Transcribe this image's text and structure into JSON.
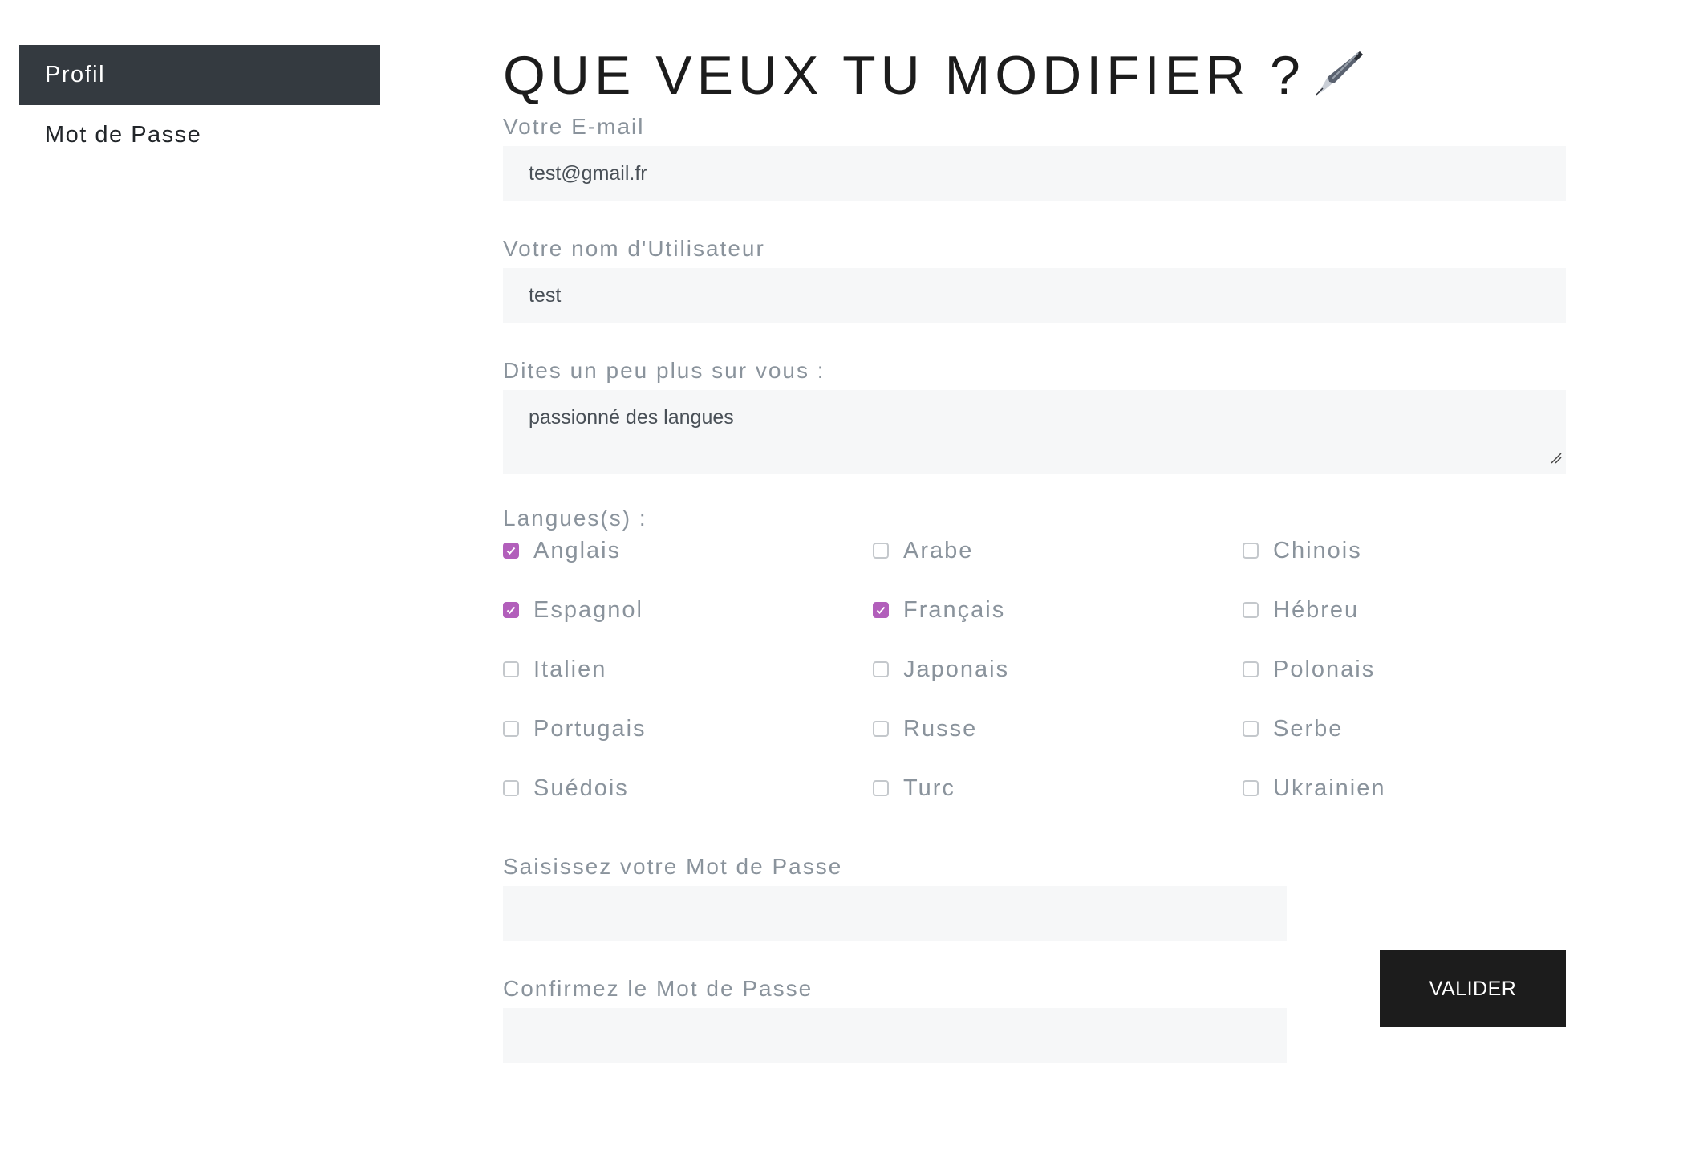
{
  "sidebar": {
    "items": [
      {
        "label": "Profil",
        "active": true
      },
      {
        "label": "Mot de Passe",
        "active": false
      }
    ]
  },
  "page": {
    "title": "QUE VEUX TU MODIFIER ?",
    "title_icon": "fountain-pen-icon"
  },
  "form": {
    "email_label": "Votre E-mail",
    "email_value": "test@gmail.fr",
    "username_label": "Votre nom d'Utilisateur",
    "username_value": "test",
    "bio_label": "Dites un peu plus sur vous :",
    "bio_value": "passionné des langues",
    "languages_label": "Langues(s) :",
    "languages": [
      {
        "label": "Anglais",
        "checked": true
      },
      {
        "label": "Arabe",
        "checked": false
      },
      {
        "label": "Chinois",
        "checked": false
      },
      {
        "label": "Espagnol",
        "checked": true
      },
      {
        "label": "Français",
        "checked": true
      },
      {
        "label": "Hébreu",
        "checked": false
      },
      {
        "label": "Italien",
        "checked": false
      },
      {
        "label": "Japonais",
        "checked": false
      },
      {
        "label": "Polonais",
        "checked": false
      },
      {
        "label": "Portugais",
        "checked": false
      },
      {
        "label": "Russe",
        "checked": false
      },
      {
        "label": "Serbe",
        "checked": false
      },
      {
        "label": "Suédois",
        "checked": false
      },
      {
        "label": "Turc",
        "checked": false
      },
      {
        "label": "Ukrainien",
        "checked": false
      }
    ],
    "password_label": "Saisissez votre Mot de Passe",
    "password_value": "",
    "confirm_label": "Confirmez le Mot de Passe",
    "confirm_value": "",
    "submit_label": "VALIDER"
  },
  "colors": {
    "sidebar_active_bg": "#343a40",
    "checkbox_checked": "#b25fbb",
    "button_bg": "#1c1c1c",
    "field_bg": "#f6f7f8",
    "label_text": "#8a939c"
  }
}
